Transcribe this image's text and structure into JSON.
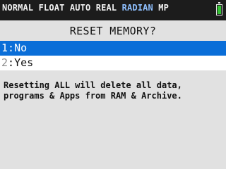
{
  "status": {
    "modes_before": "NORMAL FLOAT AUTO REAL ",
    "angle_mode": "RADIAN",
    "modes_after": " MP",
    "battery_icon": "battery-icon",
    "battery_color": "#34c234"
  },
  "dialog": {
    "title": "RESET MEMORY?",
    "options": [
      {
        "number": "1",
        "separator": ":",
        "label": "No"
      },
      {
        "number": "2",
        "separator": ":",
        "label": "Yes"
      }
    ],
    "warning": "Resetting ALL will delete all data,\nprograms & Apps from RAM & Archive."
  },
  "colors": {
    "selection": "#0a6ed8",
    "radian_highlight": "#8fc0ff",
    "status_bar": "#1c1c1c",
    "screen_bg": "#e1e1e1"
  }
}
